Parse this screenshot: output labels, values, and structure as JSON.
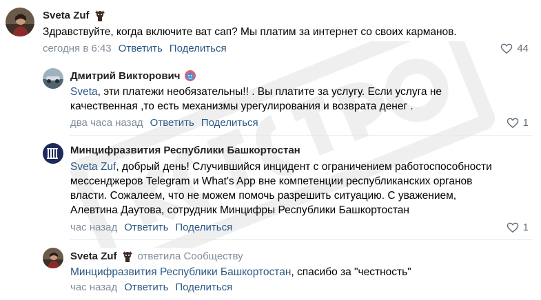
{
  "comments": [
    {
      "author": "Sveta Zuf",
      "text": "Здравствуйте, когда включите ват сап? Мы платим за интернет со своих карманов.",
      "time": "сегодня в 6:43",
      "reply_label": "Ответить",
      "share_label": "Поделиться",
      "likes": "44"
    },
    {
      "author": "Дмитрий Викторович",
      "mention": "Sveta",
      "text_line1_rest": ", эти платежи необязательны!! . Вы платите за услугу. Если услуга не",
      "text_line2": "качественная ,то есть механизмы урегулирования и возврата денег .",
      "time": "два часа назад",
      "reply_label": "Ответить",
      "share_label": "Поделиться",
      "likes": "1"
    },
    {
      "author": "Минцифразвития Республики Башкортостан",
      "mention": "Sveta Zuf",
      "text_line1_rest": ", добрый день! Случившийся инцидент с ограничением работоспособности",
      "text_line2": "мессенджеров Telegram и What's App вне компетенции республиканских органов",
      "text_line3": "власти. Сожалеем, что не можем помочь разрешить ситуацию. С уважением,",
      "text_line4": "Алевтина Даутова, сотрудник Минцифры Республики Башкортостан",
      "time": "час назад",
      "reply_label": "Ответить",
      "share_label": "Поделиться",
      "likes": "1"
    },
    {
      "author": "Sveta Zuf",
      "replied_label": "ответила Сообществу",
      "mention": "Минцифразвития Республики Башкортостан",
      "text_rest": ", спасибо за \"честность\"",
      "time": "час назад",
      "reply_label": "Ответить",
      "share_label": "Поделиться"
    }
  ],
  "icons": {
    "like": "heart-outline-icon",
    "badge": "cat-sticker-icon",
    "emoji": "face-emoji-icon"
  },
  "colors": {
    "link": "#2a5885",
    "secondary": "#818c99",
    "divider": "#e7e8ec"
  }
}
